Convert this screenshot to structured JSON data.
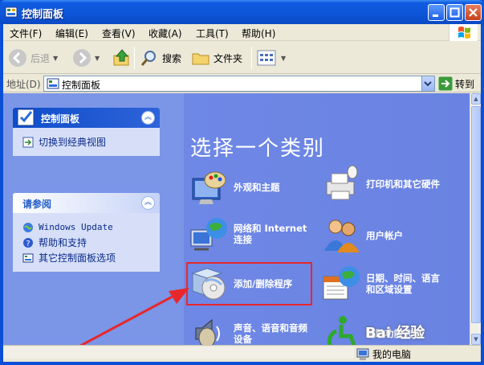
{
  "window": {
    "title": "控制面板"
  },
  "menu": [
    "文件(F)",
    "编辑(E)",
    "查看(V)",
    "收藏(A)",
    "工具(T)",
    "帮助(H)"
  ],
  "toolbar": {
    "back": "后退",
    "search": "搜索",
    "folders": "文件夹"
  },
  "address": {
    "label": "地址(D)",
    "value": "控制面板",
    "go": "转到"
  },
  "sidebar": {
    "control_panel": {
      "title": "控制面板",
      "switch_view": "切换到经典视图"
    },
    "see_also": {
      "title": "请参阅",
      "items": [
        "Windows Update",
        "帮助和支持",
        "其它控制面板选项"
      ]
    }
  },
  "main": {
    "heading": "选择一个类别",
    "categories": [
      {
        "label": "外观和主题",
        "icon": "appearance-icon"
      },
      {
        "label": "打印机和其它硬件",
        "icon": "printer-icon"
      },
      {
        "label": "网络和 Internet 连接",
        "icon": "network-icon"
      },
      {
        "label": "用户帐户",
        "icon": "users-icon"
      },
      {
        "label": "添加/删除程序",
        "icon": "add-remove-programs-icon"
      },
      {
        "label": "日期、时间、语言和区域设置",
        "icon": "date-time-icon"
      },
      {
        "label": "声音、语音和音频设备",
        "icon": "sound-icon"
      },
      {
        "label": "辅助功能选项",
        "icon": "accessibility-icon"
      }
    ]
  },
  "status": {
    "computer": "我的电脑"
  },
  "watermark": "Bai 经验",
  "colors": {
    "title_bar": "#0d55d8",
    "content_bg": "#6f88e6",
    "highlight": "#e8272a"
  }
}
